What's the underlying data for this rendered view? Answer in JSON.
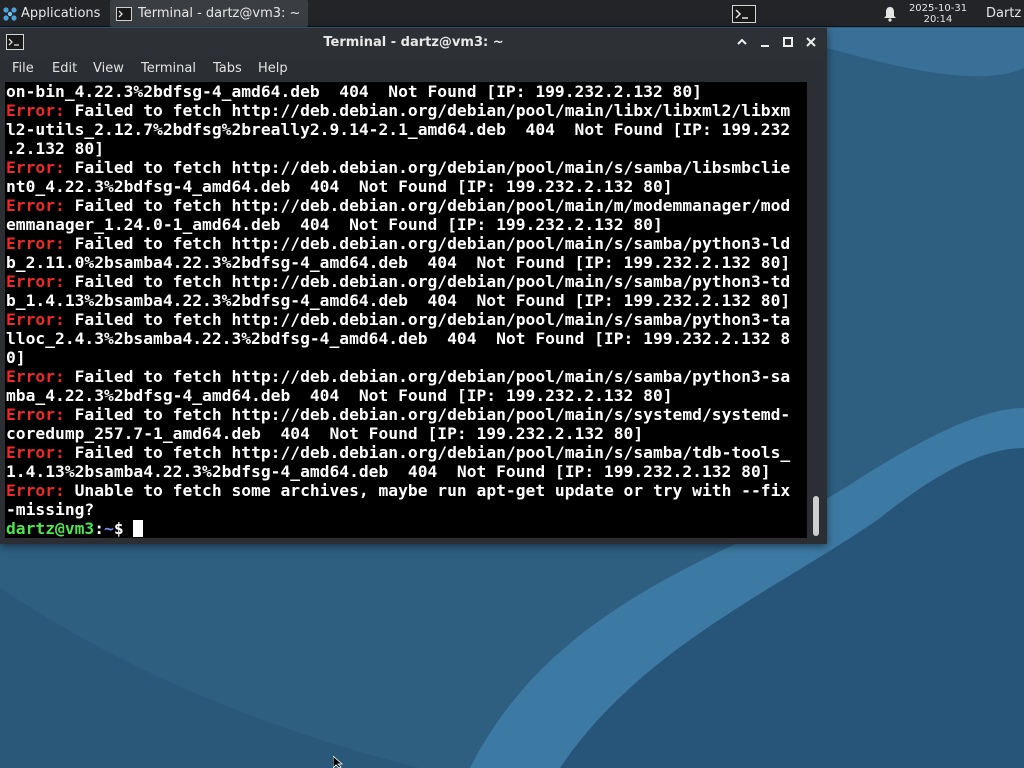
{
  "panel": {
    "applications_label": "Applications",
    "taskbar_window_title": "Terminal - dartz@vm3: ~",
    "clock_date": "2025-10-31",
    "clock_time": "20:14",
    "user_label": "Dartz"
  },
  "window": {
    "title": "Terminal - dartz@vm3: ~",
    "menu": [
      "File",
      "Edit",
      "View",
      "Terminal",
      "Tabs",
      "Help"
    ]
  },
  "terminal": {
    "lines": [
      {
        "err": "",
        "text": "on-bin_4.22.3%2bdfsg-4_amd64.deb  404  Not Found [IP: 199.232.2.132 80]"
      },
      {
        "err": "Error:",
        "text": " Failed to fetch http://deb.debian.org/debian/pool/main/libx/libxml2/libxm"
      },
      {
        "err": "",
        "text": "l2-utils_2.12.7%2bdfsg%2breally2.9.14-2.1_amd64.deb  404  Not Found [IP: 199.232"
      },
      {
        "err": "",
        "text": ".2.132 80]"
      },
      {
        "err": "Error:",
        "text": " Failed to fetch http://deb.debian.org/debian/pool/main/s/samba/libsmbclie"
      },
      {
        "err": "",
        "text": "nt0_4.22.3%2bdfsg-4_amd64.deb  404  Not Found [IP: 199.232.2.132 80]"
      },
      {
        "err": "Error:",
        "text": " Failed to fetch http://deb.debian.org/debian/pool/main/m/modemmanager/mod"
      },
      {
        "err": "",
        "text": "emmanager_1.24.0-1_amd64.deb  404  Not Found [IP: 199.232.2.132 80]"
      },
      {
        "err": "Error:",
        "text": " Failed to fetch http://deb.debian.org/debian/pool/main/s/samba/python3-ld"
      },
      {
        "err": "",
        "text": "b_2.11.0%2bsamba4.22.3%2bdfsg-4_amd64.deb  404  Not Found [IP: 199.232.2.132 80]"
      },
      {
        "err": "Error:",
        "text": " Failed to fetch http://deb.debian.org/debian/pool/main/s/samba/python3-td"
      },
      {
        "err": "",
        "text": "b_1.4.13%2bsamba4.22.3%2bdfsg-4_amd64.deb  404  Not Found [IP: 199.232.2.132 80]"
      },
      {
        "err": "Error:",
        "text": " Failed to fetch http://deb.debian.org/debian/pool/main/s/samba/python3-ta"
      },
      {
        "err": "",
        "text": "lloc_2.4.3%2bsamba4.22.3%2bdfsg-4_amd64.deb  404  Not Found [IP: 199.232.2.132 8"
      },
      {
        "err": "",
        "text": "0]"
      },
      {
        "err": "Error:",
        "text": " Failed to fetch http://deb.debian.org/debian/pool/main/s/samba/python3-sa"
      },
      {
        "err": "",
        "text": "mba_4.22.3%2bdfsg-4_amd64.deb  404  Not Found [IP: 199.232.2.132 80]"
      },
      {
        "err": "Error:",
        "text": " Failed to fetch http://deb.debian.org/debian/pool/main/s/systemd/systemd-"
      },
      {
        "err": "",
        "text": "coredump_257.7-1_amd64.deb  404  Not Found [IP: 199.232.2.132 80]"
      },
      {
        "err": "Error:",
        "text": " Failed to fetch http://deb.debian.org/debian/pool/main/s/samba/tdb-tools_"
      },
      {
        "err": "",
        "text": "1.4.13%2bsamba4.22.3%2bdfsg-4_amd64.deb  404  Not Found [IP: 199.232.2.132 80]"
      },
      {
        "err": "Error:",
        "text": " Unable to fetch some archives, maybe run apt-get update or try with --fix"
      },
      {
        "err": "",
        "text": "-missing?"
      }
    ],
    "prompt_user": "dartz@vm3",
    "prompt_sep": ":",
    "prompt_path": "~",
    "prompt_symbol": "$ "
  },
  "colors": {
    "desktop": "#2f5f80",
    "error_red": "#ef2929",
    "prompt_green": "#4ee44e",
    "prompt_blue": "#6f8ff4"
  },
  "icons": [
    "applications-menu-icon",
    "terminal-icon",
    "bell-icon",
    "chevron-up-icon",
    "minimize-icon",
    "maximize-icon",
    "close-icon",
    "mouse-pointer-icon"
  ]
}
